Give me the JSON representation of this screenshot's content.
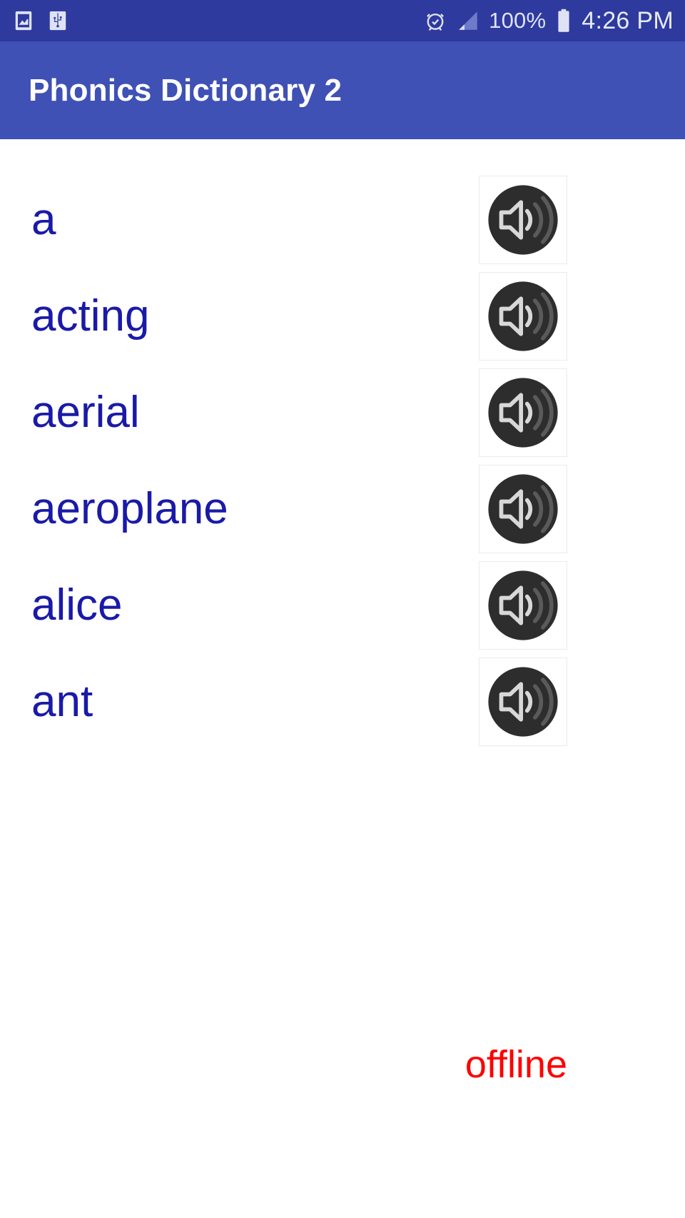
{
  "status_bar": {
    "left_icons": [
      {
        "name": "screenshot-icon",
        "label": "screenshot"
      },
      {
        "name": "usb-icon",
        "label": "usb"
      }
    ],
    "right_icons": [
      {
        "name": "alarm-clock-icon",
        "label": "alarm"
      },
      {
        "name": "signal-bars-icon",
        "label": "signal"
      }
    ],
    "battery_percent": "100%",
    "battery_icon": "battery-full-icon",
    "clock": "4:26 PM",
    "background_color": "#2e3a9e",
    "text_color": "#dfe2f2"
  },
  "app_bar": {
    "title": "Phonics Dictionary 2",
    "background_color": "#3f51b5",
    "title_color": "#ffffff"
  },
  "main": {
    "word_color": "#1a1aa8",
    "speak_icon_name": "speaker-volume-icon",
    "words": [
      {
        "word": "a",
        "speak_label": "play a"
      },
      {
        "word": "acting",
        "speak_label": "play acting"
      },
      {
        "word": "aerial",
        "speak_label": "play aerial"
      },
      {
        "word": "aeroplane",
        "speak_label": "play aeroplane"
      },
      {
        "word": "alice",
        "speak_label": "play alice"
      },
      {
        "word": "ant",
        "speak_label": "play ant"
      }
    ]
  },
  "footer": {
    "status_text": "offline",
    "status_color": "#fe0000"
  }
}
